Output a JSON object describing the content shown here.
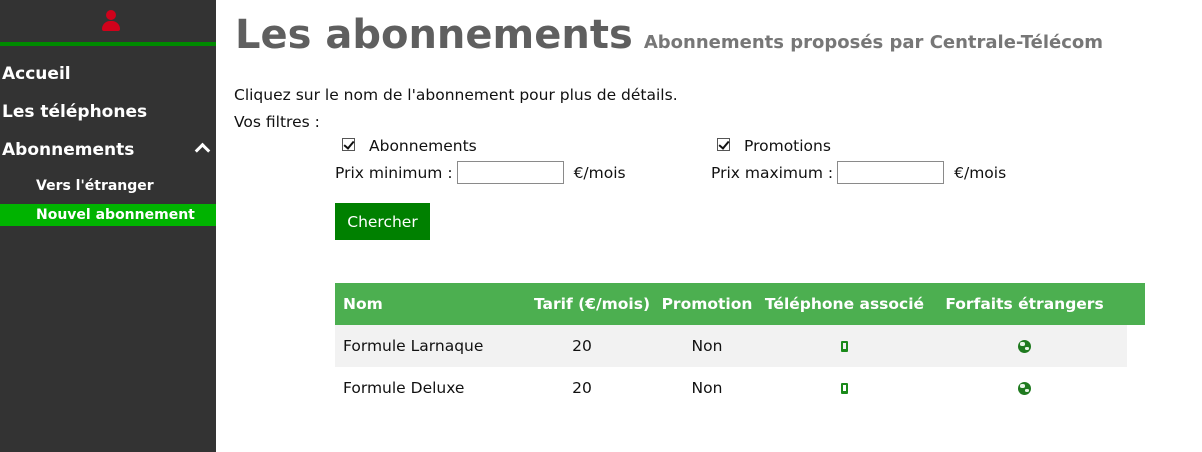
{
  "sidebar": {
    "nav": [
      {
        "label": "Accueil"
      },
      {
        "label": "Les téléphones"
      },
      {
        "label": "Abonnements"
      }
    ],
    "subnav": [
      {
        "label": "Vers l'étranger"
      },
      {
        "label": "Nouvel abonnement"
      }
    ],
    "active_color": "#00b300"
  },
  "header": {
    "title": "Les abonnements",
    "subtitle": "Abonnements proposés par Centrale-Télécom"
  },
  "intro": "Cliquez sur le nom de l'abonnement pour plus de détails.",
  "filters": {
    "label": "Vos filtres :",
    "checkbox_abonnements": {
      "label": "Abonnements",
      "checked": true
    },
    "checkbox_promotions": {
      "label": "Promotions",
      "checked": true
    },
    "min_label": "Prix minimum :",
    "max_label": "Prix maximum :",
    "min_value": "",
    "max_value": "",
    "unit": "€/mois",
    "search_button": "Chercher"
  },
  "table": {
    "headers": [
      "Nom",
      "Tarif (€/mois)",
      "Promotion",
      "Téléphone associé",
      "Forfaits étrangers"
    ],
    "rows": [
      {
        "nom": "Formule Larnaque",
        "tarif": "20",
        "promotion": "Non",
        "telephone_icon": "phone-icon",
        "forfaits_icon": "globe-icon"
      },
      {
        "nom": "Formule Deluxe",
        "tarif": "20",
        "promotion": "Non",
        "telephone_icon": "phone-icon",
        "forfaits_icon": "globe-icon"
      }
    ],
    "header_color": "#4caf50"
  },
  "colors": {
    "sidebar_bg": "#333333",
    "accent_green": "#008000",
    "user_icon": "#d0021b"
  }
}
